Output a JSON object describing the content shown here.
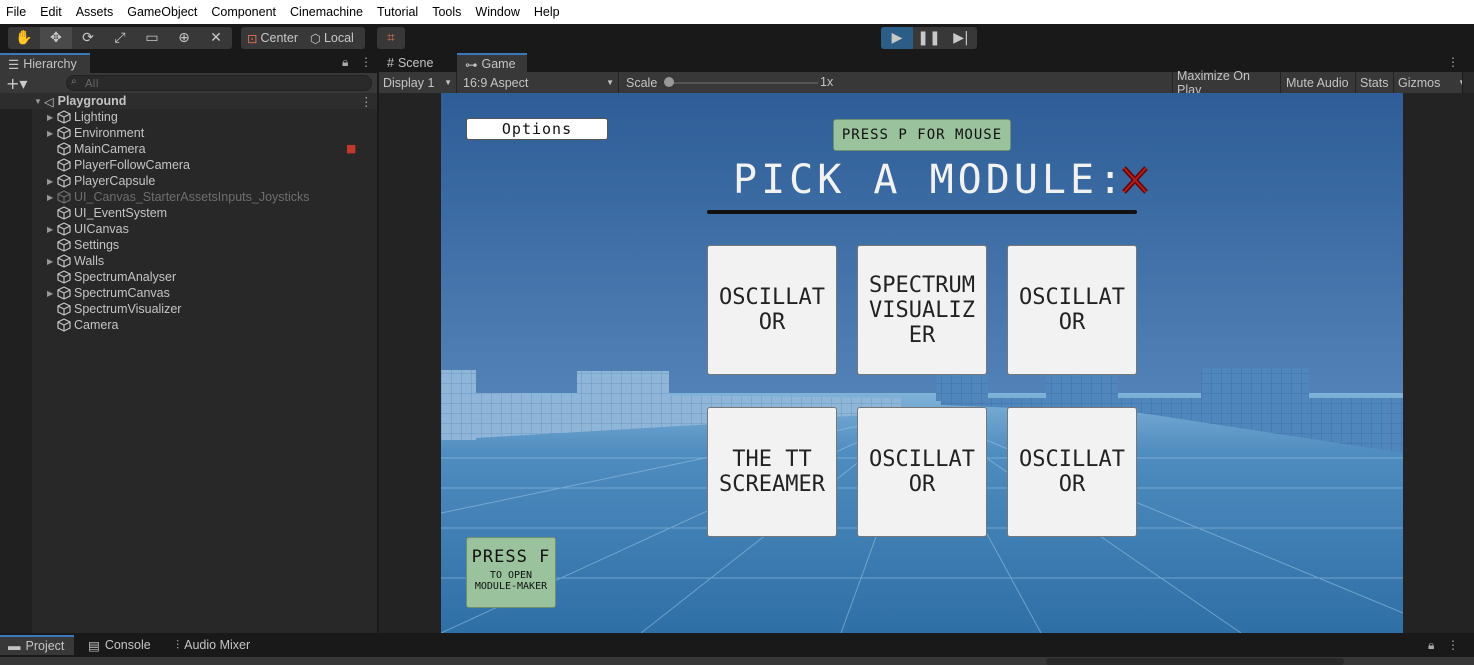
{
  "menu": [
    "File",
    "Edit",
    "Assets",
    "GameObject",
    "Component",
    "Cinemachine",
    "Tutorial",
    "Tools",
    "Window",
    "Help"
  ],
  "toolbar": {
    "pivot_label": "Center",
    "space_label": "Local"
  },
  "hierarchy": {
    "title": "Hierarchy",
    "search_placeholder": "All",
    "scene_name": "Playground",
    "items": [
      {
        "label": "Lighting",
        "expandable": true
      },
      {
        "label": "Environment",
        "expandable": true
      },
      {
        "label": "MainCamera",
        "expandable": false
      },
      {
        "label": "PlayerFollowCamera",
        "expandable": false
      },
      {
        "label": "PlayerCapsule",
        "expandable": true
      },
      {
        "label": "UI_Canvas_StarterAssetsInputs_Joysticks",
        "expandable": true,
        "disabled": true
      },
      {
        "label": "UI_EventSystem",
        "expandable": false
      },
      {
        "label": "UICanvas",
        "expandable": true
      },
      {
        "label": "Settings",
        "expandable": false
      },
      {
        "label": "Walls",
        "expandable": true
      },
      {
        "label": "SpectrumAnalyser",
        "expandable": false
      },
      {
        "label": "SpectrumCanvas",
        "expandable": true
      },
      {
        "label": "SpectrumVisualizer",
        "expandable": false
      },
      {
        "label": "Camera",
        "expandable": false
      }
    ]
  },
  "view_tabs": {
    "scene": "Scene",
    "game": "Game"
  },
  "game_bar": {
    "display": "Display 1",
    "aspect": "16:9 Aspect",
    "scale_label": "Scale",
    "scale_value": "1x",
    "maximize": "Maximize On Play",
    "mute": "Mute Audio",
    "stats": "Stats",
    "gizmos": "Gizmos"
  },
  "game": {
    "options_label": "Options",
    "mouse_hint": "PRESS P FOR MOUSE",
    "heading": "PICK A MODULE:",
    "modules": [
      "OSCILLAT\nOR",
      "SPECTRUM\nVISUALIZ\nER",
      "OSCILLAT\nOR",
      "THE TT\nSCREAMER",
      "OSCILLAT\nOR",
      "OSCILLAT\nOR"
    ],
    "press_f": "PRESS F",
    "press_f_sub": "TO OPEN\nMODULE-MAKER"
  },
  "bottom_tabs": [
    "Project",
    "Console",
    "Audio Mixer"
  ],
  "colors": {
    "accent": "#3a79bb",
    "play_active": "#2c5d87"
  }
}
